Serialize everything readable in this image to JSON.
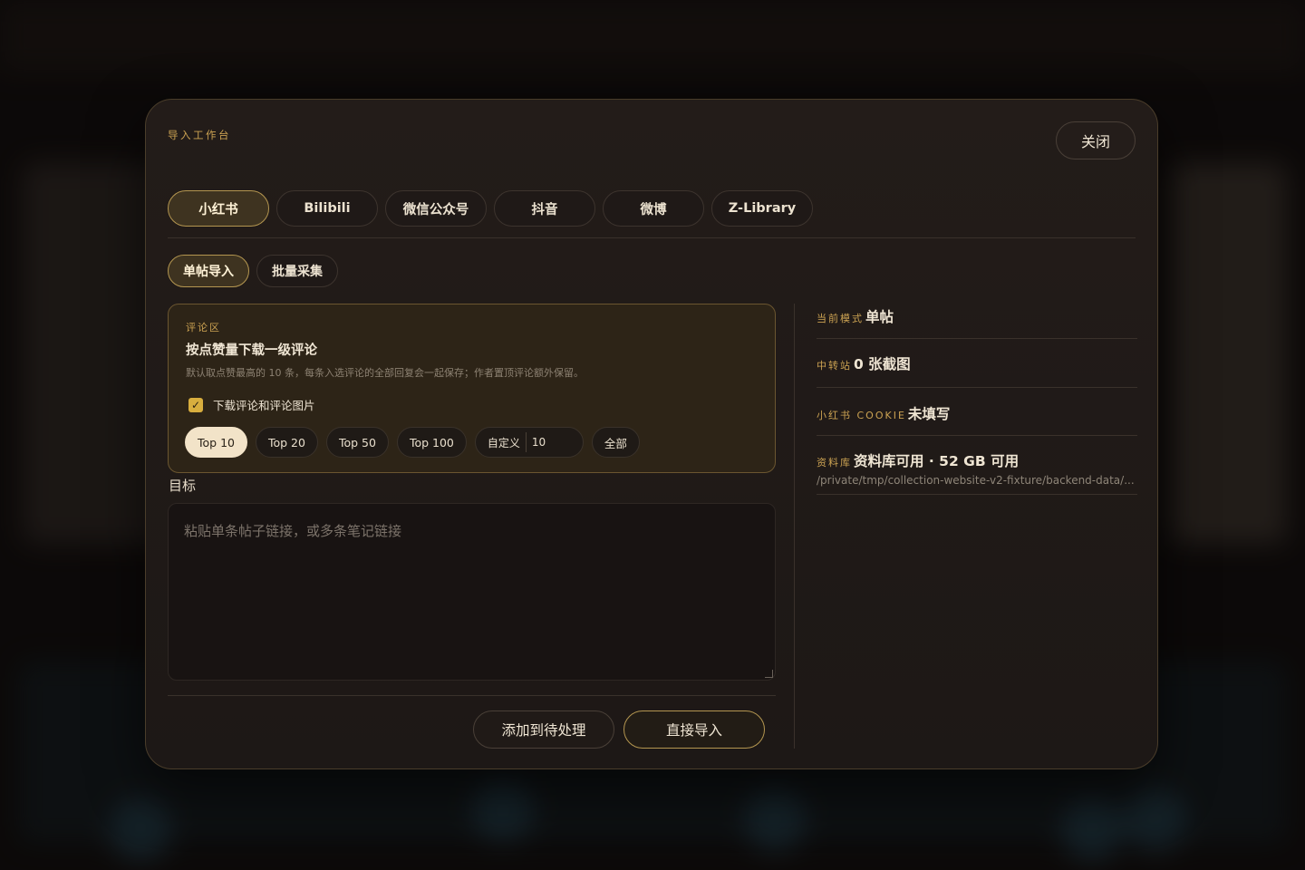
{
  "modal": {
    "eyebrow": "导入工作台",
    "close_label": "关闭"
  },
  "platform_tabs": [
    {
      "label": "小红书",
      "active": true
    },
    {
      "label": "Bilibili",
      "active": false
    },
    {
      "label": "微信公众号",
      "active": false
    },
    {
      "label": "抖音",
      "active": false
    },
    {
      "label": "微博",
      "active": false
    },
    {
      "label": "Z-Library",
      "active": false
    }
  ],
  "mode_tabs": [
    {
      "label": "单帖导入",
      "active": true
    },
    {
      "label": "批量采集",
      "active": false
    }
  ],
  "comments": {
    "eyebrow": "评论区",
    "title": "按点赞量下载一级评论",
    "description": "默认取点赞最高的 10 条，每条入选评论的全部回复会一起保存；作者置顶评论额外保留。",
    "checkbox_label": "下载评论和评论图片",
    "checkbox_checked": true,
    "options": [
      "Top 10",
      "Top 20",
      "Top 50",
      "Top 100"
    ],
    "selected_option": "Top 10",
    "custom_label": "自定义",
    "custom_value": "10",
    "all_label": "全部"
  },
  "target": {
    "label": "目标",
    "placeholder": "粘贴单条帖子链接，或多条笔记链接"
  },
  "actions": {
    "queue_label": "添加到待处理",
    "import_label": "直接导入"
  },
  "info": {
    "mode_key": "当前模式",
    "mode_value": "单帖",
    "relay_key": "中转站",
    "relay_value": "0 张截图",
    "cookie_key": "小红书 COOKIE",
    "cookie_value": "未填写",
    "library_key": "资料库",
    "library_value": "资料库可用 · 52 GB 可用",
    "library_path": "/private/tmp/collection-website-v2-fixture/backend-data/..."
  },
  "colors": {
    "accent": "#cba252",
    "active_tab_border": "#b49650",
    "checkbox": "#d8ae3e",
    "selected_chip": "#f2e3c8"
  }
}
